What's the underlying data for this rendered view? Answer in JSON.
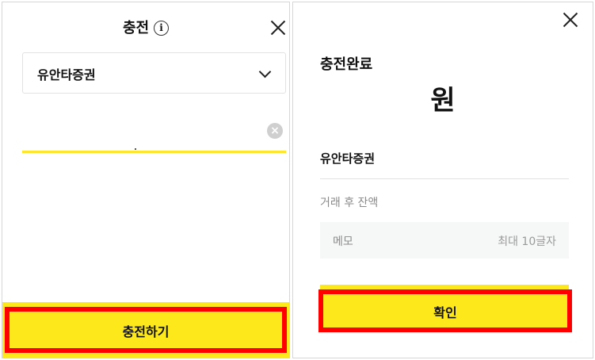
{
  "left_panel": {
    "title": "충전",
    "info_icon": "info-icon",
    "close_icon": "close-icon",
    "select": {
      "selected": "유안타증권",
      "icon": "chevron-down-icon"
    },
    "amount_input": {
      "value": "",
      "clear_icon": "clear-icon"
    },
    "charge_button": {
      "label": "충전하기"
    }
  },
  "right_panel": {
    "close_icon": "close-icon",
    "title": "충전완료",
    "amount_unit": "원",
    "account_name": "유안타증권",
    "balance_label": "거래 후 잔액",
    "memo": {
      "label": "메모",
      "limit_hint": "최대 10글자"
    },
    "confirm_button": {
      "label": "확인"
    }
  },
  "colors": {
    "accent_yellow": "#fde91b",
    "highlight_red": "#ff0000",
    "input_underline": "#ffe62e"
  }
}
